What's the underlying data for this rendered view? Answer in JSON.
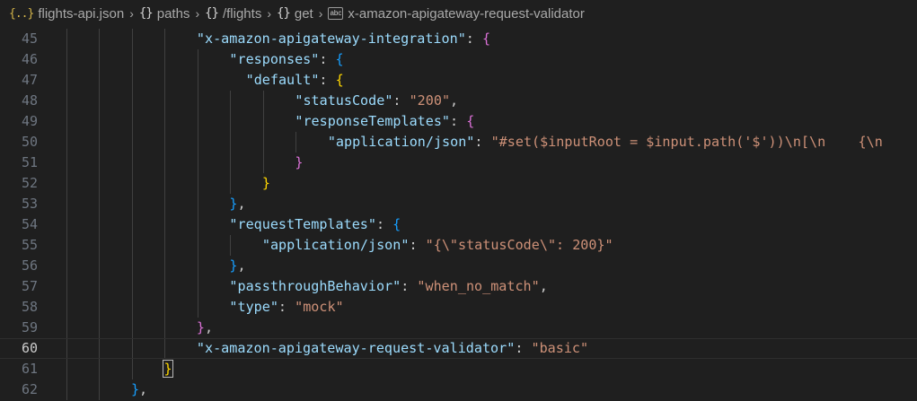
{
  "breadcrumb": [
    {
      "icon": "json-file-icon",
      "glyph": "{..}",
      "label": "flights-api.json"
    },
    {
      "icon": "object-icon",
      "glyph": "{}",
      "label": "paths"
    },
    {
      "icon": "object-icon",
      "glyph": "{}",
      "label": "/flights"
    },
    {
      "icon": "object-icon",
      "glyph": "{}",
      "label": "get"
    },
    {
      "icon": "string-icon",
      "glyph": "abc",
      "label": "x-amazon-apigateway-request-validator"
    }
  ],
  "editor": {
    "current_line": 60,
    "lines": [
      {
        "n": "45",
        "indent": 4,
        "tokens": [
          [
            "k",
            "\"x-amazon-apigateway-integration\""
          ],
          [
            "p",
            ": "
          ],
          [
            "b2",
            "{"
          ]
        ]
      },
      {
        "n": "46",
        "indent": 5,
        "tokens": [
          [
            "k",
            "\"responses\""
          ],
          [
            "p",
            ": "
          ],
          [
            "b3",
            "{"
          ]
        ]
      },
      {
        "n": "47",
        "indent": 5,
        "extra": 2,
        "tokens": [
          [
            "k",
            "\"default\""
          ],
          [
            "p",
            ": "
          ],
          [
            "b1",
            "{"
          ]
        ]
      },
      {
        "n": "48",
        "indent": 7,
        "tokens": [
          [
            "k",
            "\"statusCode\""
          ],
          [
            "p",
            ": "
          ],
          [
            "s",
            "\"200\""
          ],
          [
            "p",
            ","
          ]
        ]
      },
      {
        "n": "49",
        "indent": 7,
        "tokens": [
          [
            "k",
            "\"responseTemplates\""
          ],
          [
            "p",
            ": "
          ],
          [
            "b2",
            "{"
          ]
        ]
      },
      {
        "n": "50",
        "indent": 8,
        "tokens": [
          [
            "k",
            "\"application/json\""
          ],
          [
            "p",
            ": "
          ],
          [
            "s",
            "\"#set($inputRoot = $input.path('$'))\\n[\\n    {\\n"
          ]
        ]
      },
      {
        "n": "51",
        "indent": 7,
        "tokens": [
          [
            "b2",
            "}"
          ]
        ]
      },
      {
        "n": "52",
        "indent": 6,
        "tokens": [
          [
            "b1",
            "}"
          ]
        ]
      },
      {
        "n": "53",
        "indent": 5,
        "tokens": [
          [
            "b3",
            "}"
          ],
          [
            "p",
            ","
          ]
        ]
      },
      {
        "n": "54",
        "indent": 5,
        "tokens": [
          [
            "k",
            "\"requestTemplates\""
          ],
          [
            "p",
            ": "
          ],
          [
            "b3",
            "{"
          ]
        ]
      },
      {
        "n": "55",
        "indent": 6,
        "tokens": [
          [
            "k",
            "\"application/json\""
          ],
          [
            "p",
            ": "
          ],
          [
            "s",
            "\"{\\\"statusCode\\\": 200}\""
          ]
        ]
      },
      {
        "n": "56",
        "indent": 5,
        "tokens": [
          [
            "b3",
            "}"
          ],
          [
            "p",
            ","
          ]
        ]
      },
      {
        "n": "57",
        "indent": 5,
        "tokens": [
          [
            "k",
            "\"passthroughBehavior\""
          ],
          [
            "p",
            ": "
          ],
          [
            "s",
            "\"when_no_match\""
          ],
          [
            "p",
            ","
          ]
        ]
      },
      {
        "n": "58",
        "indent": 5,
        "tokens": [
          [
            "k",
            "\"type\""
          ],
          [
            "p",
            ": "
          ],
          [
            "s",
            "\"mock\""
          ]
        ]
      },
      {
        "n": "59",
        "indent": 4,
        "tokens": [
          [
            "b2",
            "}"
          ],
          [
            "p",
            ","
          ]
        ]
      },
      {
        "n": "60",
        "indent": 4,
        "tokens": [
          [
            "k",
            "\"x-amazon-apigateway-request-validator\""
          ],
          [
            "p",
            ": "
          ],
          [
            "s",
            "\"basic\""
          ]
        ]
      },
      {
        "n": "61",
        "indent": 3,
        "tokens": [
          [
            "b1m",
            "}"
          ]
        ]
      },
      {
        "n": "62",
        "indent": 2,
        "tokens": [
          [
            "b3",
            "}"
          ],
          [
            "p",
            ","
          ]
        ]
      }
    ]
  }
}
